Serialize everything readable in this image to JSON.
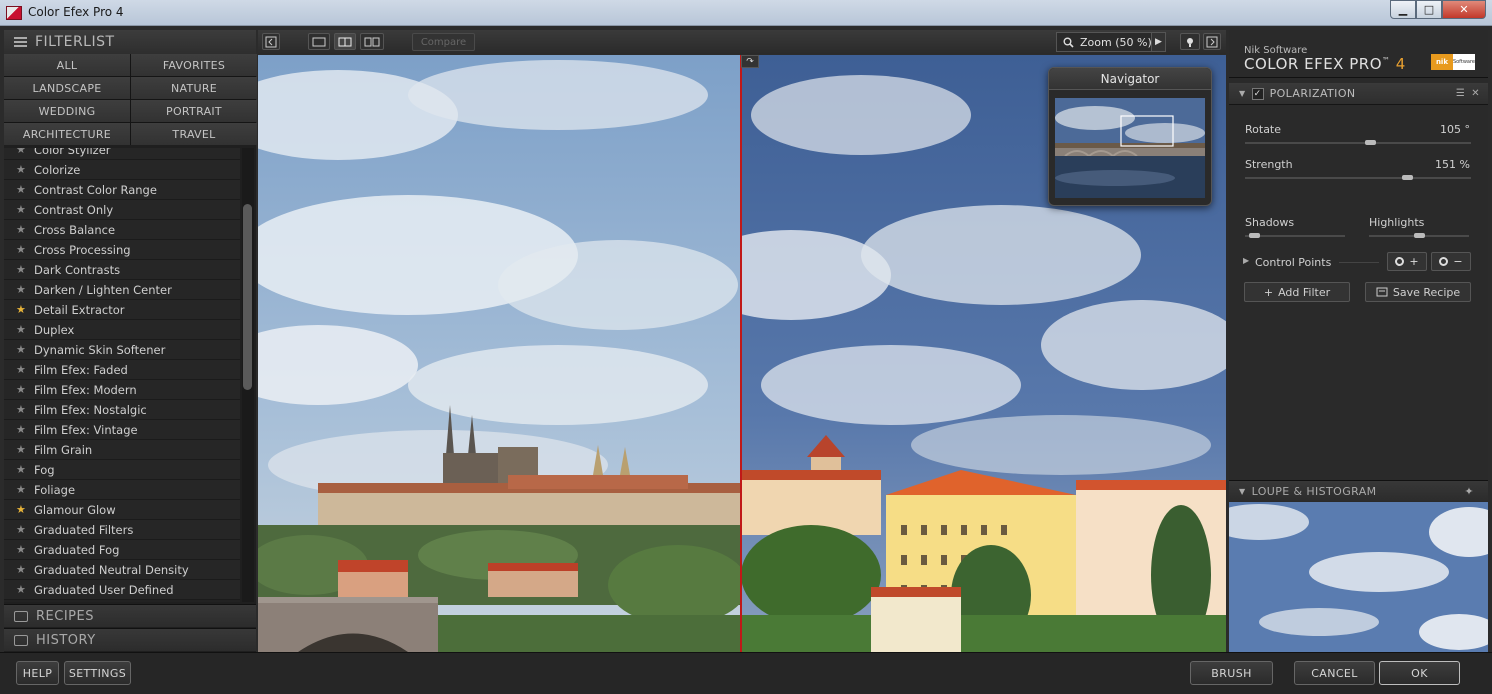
{
  "window": {
    "title": "Color Efex Pro 4",
    "min": "▁",
    "max": "□",
    "close": "✕"
  },
  "left": {
    "header": "FILTERLIST",
    "categories": [
      "ALL",
      "FAVORITES",
      "LANDSCAPE",
      "NATURE",
      "WEDDING",
      "PORTRAIT",
      "ARCHITECTURE",
      "TRAVEL"
    ],
    "filters": [
      {
        "label": "Color Stylizer",
        "fav": false
      },
      {
        "label": "Colorize",
        "fav": false
      },
      {
        "label": "Contrast Color Range",
        "fav": false
      },
      {
        "label": "Contrast Only",
        "fav": false
      },
      {
        "label": "Cross Balance",
        "fav": false
      },
      {
        "label": "Cross Processing",
        "fav": false
      },
      {
        "label": "Dark Contrasts",
        "fav": false
      },
      {
        "label": "Darken / Lighten Center",
        "fav": false
      },
      {
        "label": "Detail Extractor",
        "fav": true
      },
      {
        "label": "Duplex",
        "fav": false
      },
      {
        "label": "Dynamic Skin Softener",
        "fav": false
      },
      {
        "label": "Film Efex: Faded",
        "fav": false
      },
      {
        "label": "Film Efex: Modern",
        "fav": false
      },
      {
        "label": "Film Efex: Nostalgic",
        "fav": false
      },
      {
        "label": "Film Efex: Vintage",
        "fav": false
      },
      {
        "label": "Film Grain",
        "fav": false
      },
      {
        "label": "Fog",
        "fav": false
      },
      {
        "label": "Foliage",
        "fav": false
      },
      {
        "label": "Glamour Glow",
        "fav": true
      },
      {
        "label": "Graduated Filters",
        "fav": false
      },
      {
        "label": "Graduated Fog",
        "fav": false
      },
      {
        "label": "Graduated Neutral Density",
        "fav": false
      },
      {
        "label": "Graduated User Defined",
        "fav": false
      }
    ],
    "recipes": "RECIPES",
    "history": "HISTORY"
  },
  "toolbar": {
    "compare": "Compare",
    "zoom": "Zoom (50 %)"
  },
  "navigator": {
    "title": "Navigator"
  },
  "right": {
    "brand_small": "Nik Software",
    "brand_product": "COLOR EFEX PRO",
    "brand_tm": "™",
    "brand_version": "4",
    "badge_left": "nik",
    "badge_right": "Software",
    "filter_name": "POLARIZATION",
    "rotate_label": "Rotate",
    "rotate_value": "105 °",
    "rotate_level": 0.56,
    "strength_label": "Strength",
    "strength_value": "151 %",
    "strength_level": 0.73,
    "shadows_label": "Shadows",
    "shadows_level": 0.05,
    "highlights_label": "Highlights",
    "highlights_level": 0.5,
    "control_points": "Control Points",
    "add_filter": "Add Filter",
    "save_recipe": "Save Recipe",
    "loupe": "LOUPE & HISTOGRAM"
  },
  "bottom": {
    "help": "HELP",
    "settings": "SETTINGS",
    "brush": "BRUSH",
    "cancel": "CANCEL",
    "ok": "OK"
  },
  "colors": {
    "accent": "#e8a030",
    "divider": "#c01818",
    "favorite_star": "#e8b43a"
  }
}
